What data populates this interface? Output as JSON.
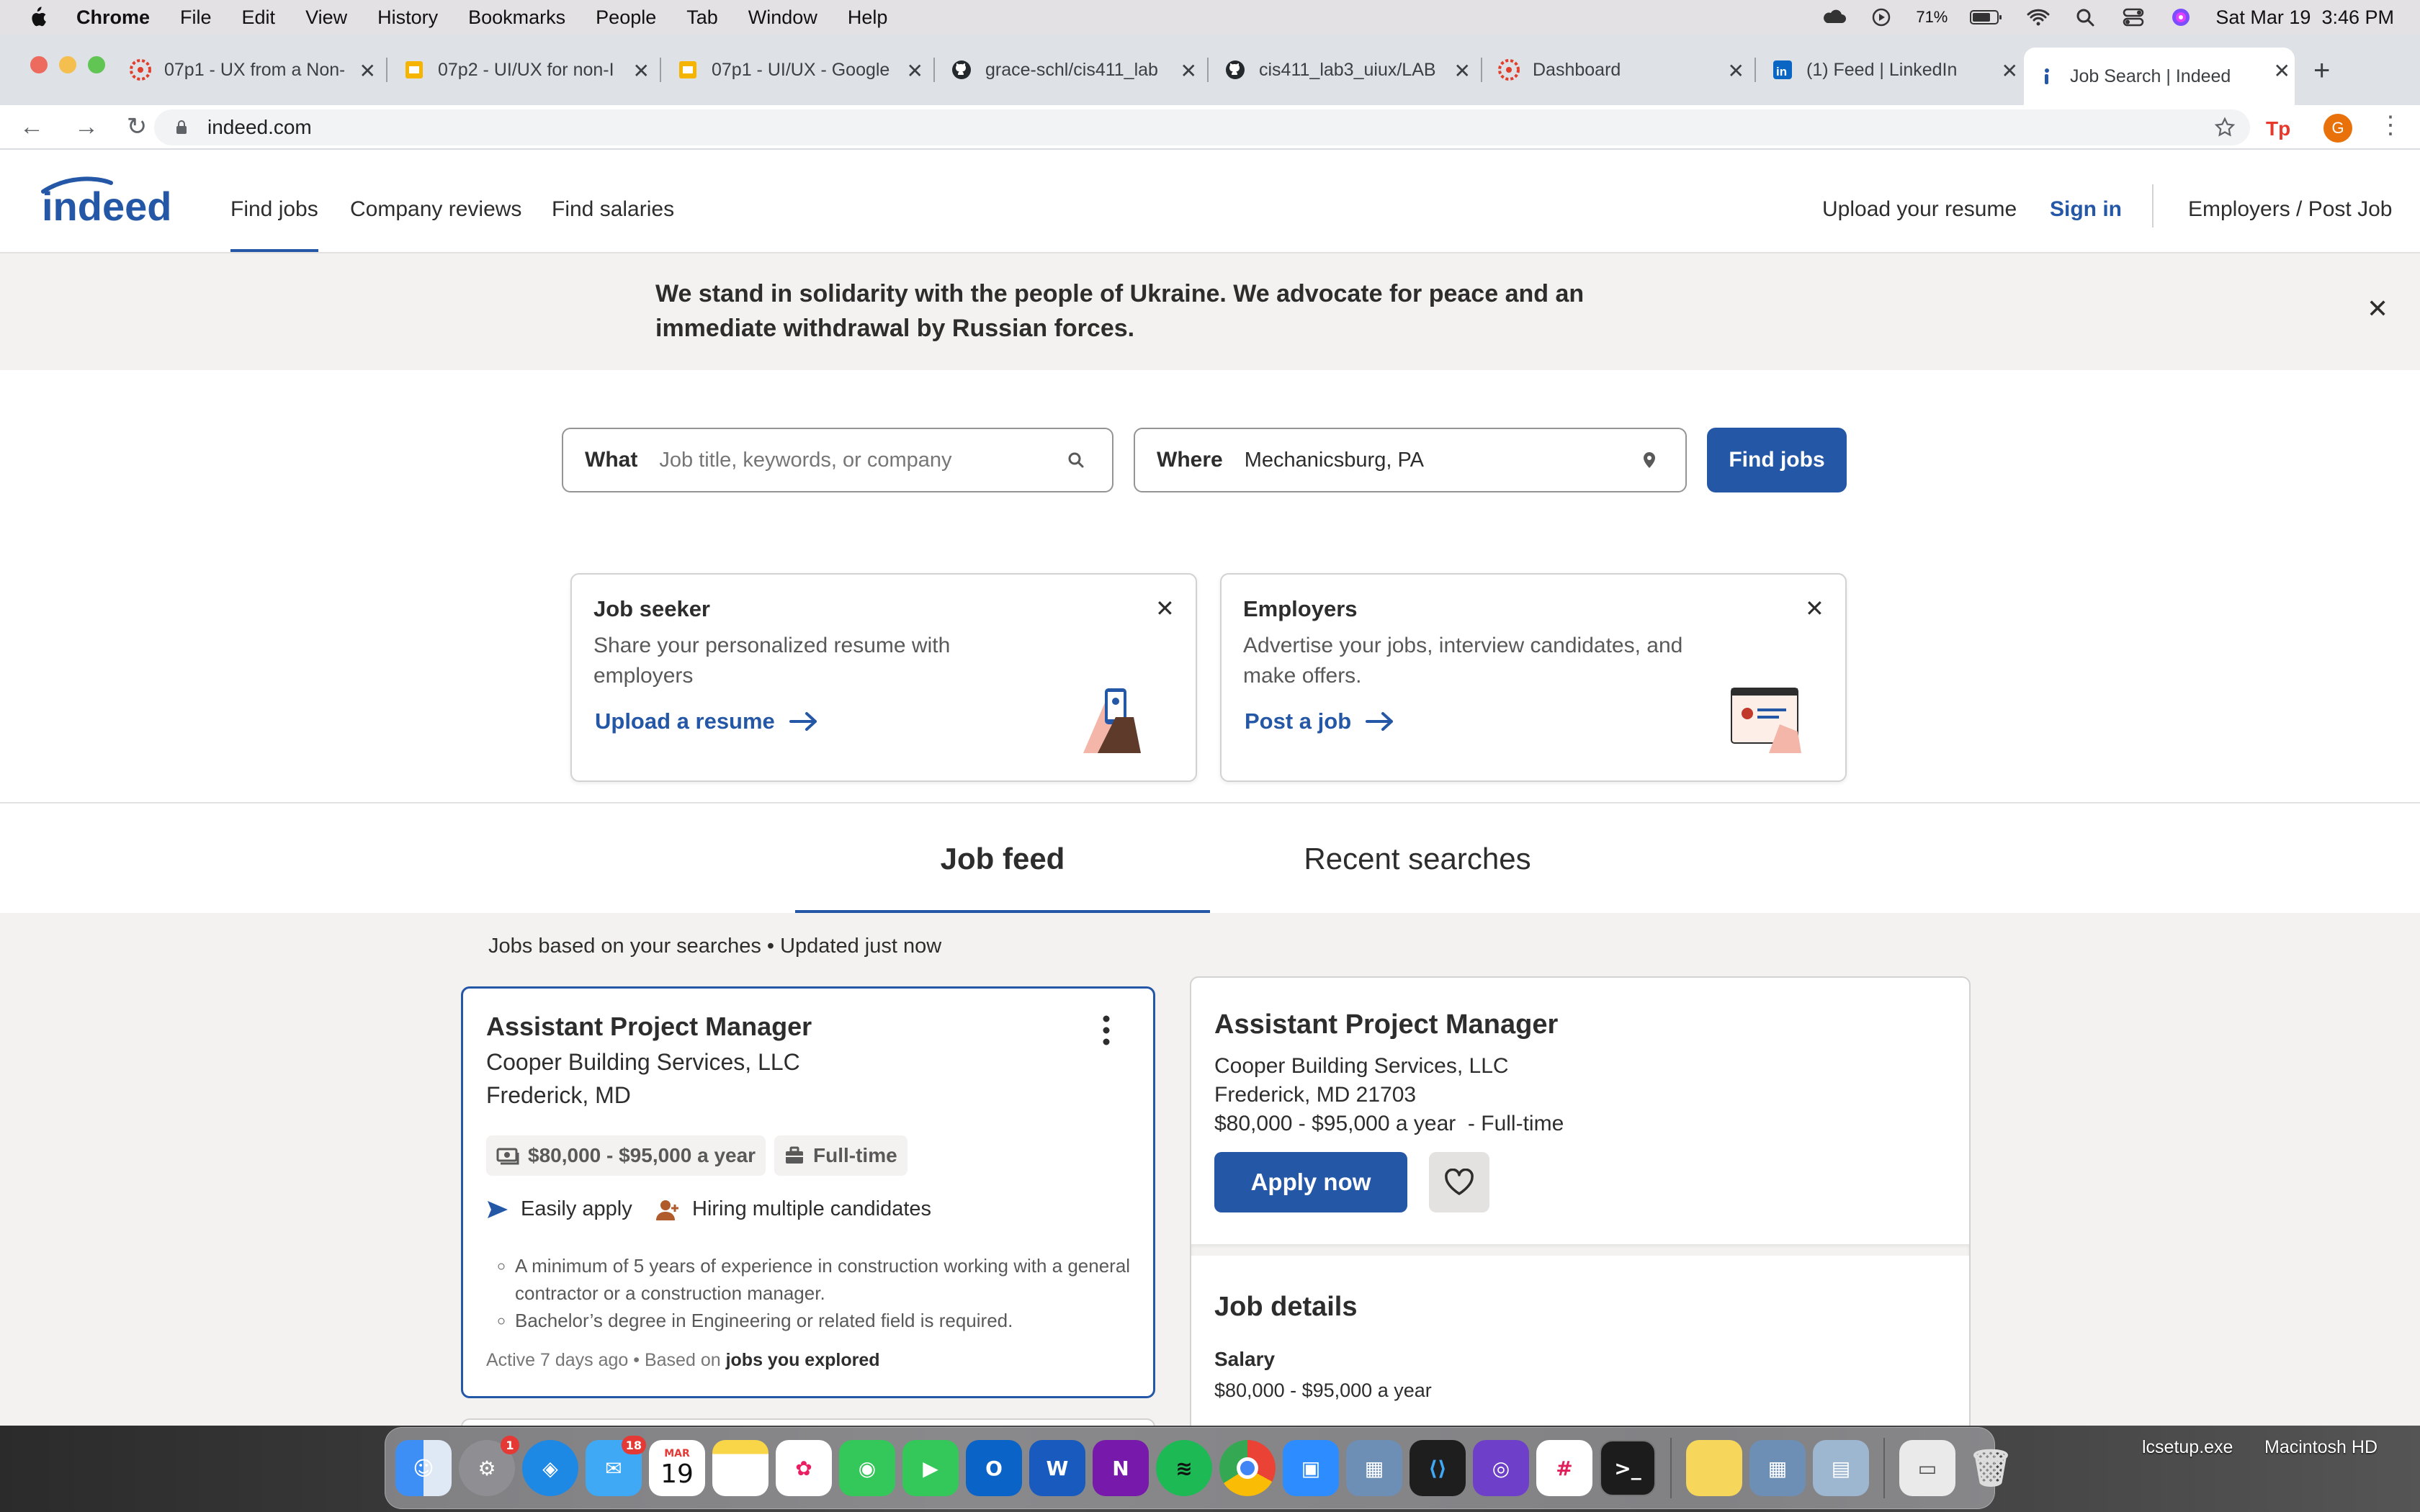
{
  "menubar": {
    "app": "Chrome",
    "items": [
      "File",
      "Edit",
      "View",
      "History",
      "Bookmarks",
      "People",
      "Tab",
      "Window",
      "Help"
    ],
    "battery": "71%",
    "datetime": "Sat Mar 19  3:46 PM"
  },
  "tabs": [
    {
      "title": "07p1 - UX from a Non-",
      "favicon": "canvas-icon"
    },
    {
      "title": "07p2 - UI/UX for non-I",
      "favicon": "slides-icon"
    },
    {
      "title": "07p1 - UI/UX - Google",
      "favicon": "slides-icon"
    },
    {
      "title": "grace-schl/cis411_lab",
      "favicon": "github-icon"
    },
    {
      "title": "cis411_lab3_uiux/LAB",
      "favicon": "github-icon"
    },
    {
      "title": "Dashboard",
      "favicon": "canvas-icon"
    },
    {
      "title": "(1) Feed | LinkedIn",
      "favicon": "linkedin-icon"
    },
    {
      "title": "Job Search | Indeed",
      "favicon": "indeed-icon"
    }
  ],
  "omnibox": {
    "url": "indeed.com"
  },
  "profile_initial": "G",
  "header": {
    "logo": "indeed",
    "nav": [
      "Find jobs",
      "Company reviews",
      "Find salaries"
    ],
    "upload_resume": "Upload your resume",
    "sign_in": "Sign in",
    "employers": "Employers / Post Job"
  },
  "banner": {
    "message": "We stand in solidarity with the people of Ukraine. We advocate for peace and an immediate withdrawal by Russian forces."
  },
  "search": {
    "what_label": "What",
    "what_placeholder": "Job title, keywords, or company",
    "where_label": "Where",
    "where_value": "Mechanicsburg, PA",
    "button": "Find jobs"
  },
  "promos": {
    "seeker": {
      "title": "Job seeker",
      "desc": "Share your personalized resume with employers",
      "cta": "Upload a resume"
    },
    "employer": {
      "title": "Employers",
      "desc": "Advertise your jobs, interview candidates, and make offers.",
      "cta": "Post a job"
    }
  },
  "feed_tabs": [
    "Job feed",
    "Recent searches"
  ],
  "feed": {
    "meta": "Jobs based on your searches • Updated just now",
    "card": {
      "title": "Assistant Project Manager",
      "company": "Cooper Building Services, LLC",
      "location": "Frederick, MD",
      "salary": "$80,000 - $95,000 a year",
      "type": "Full-time",
      "easily_apply": "Easily apply",
      "hiring": "Hiring multiple candidates",
      "bullets": [
        "A minimum of 5 years of experience in construction working with a general contractor or a construction manager.",
        "Bachelor’s degree in Engineering or related field is required."
      ],
      "active_prefix": "Active 7 days ago • Based on ",
      "active_bold": "jobs you explored"
    }
  },
  "detail": {
    "title": "Assistant Project Manager",
    "company": "Cooper Building Services, LLC",
    "location": "Frederick, MD 21703",
    "salary_type": "$80,000 - $95,000 a year  - Full-time",
    "apply": "Apply now",
    "job_details": "Job details",
    "salary_label": "Salary",
    "salary_value": "$80,000 - $95,000 a year"
  },
  "dock": {
    "apps": [
      "finder-icon",
      "system-preferences-icon",
      "safari-icon",
      "mail-icon",
      "calendar-icon",
      "notes-icon",
      "photos-icon",
      "messages-icon",
      "facetime-icon",
      "outlook-icon",
      "word-icon",
      "onenote-icon",
      "spotify-icon",
      "chrome-icon",
      "zoom-icon",
      "virtualbox-icon",
      "vscode-icon",
      "github-desktop-icon",
      "slack-icon",
      "terminal-icon"
    ],
    "badges": {
      "system_prefs": "1",
      "mail": "18"
    },
    "calendar_month": "MAR",
    "calendar_day": "19"
  },
  "desktop": {
    "file1": "lcsetup.exe",
    "drive": "Macintosh HD"
  },
  "colors": {
    "indeed_blue": "#2557a7",
    "indeed_gold": "#ffb100"
  }
}
